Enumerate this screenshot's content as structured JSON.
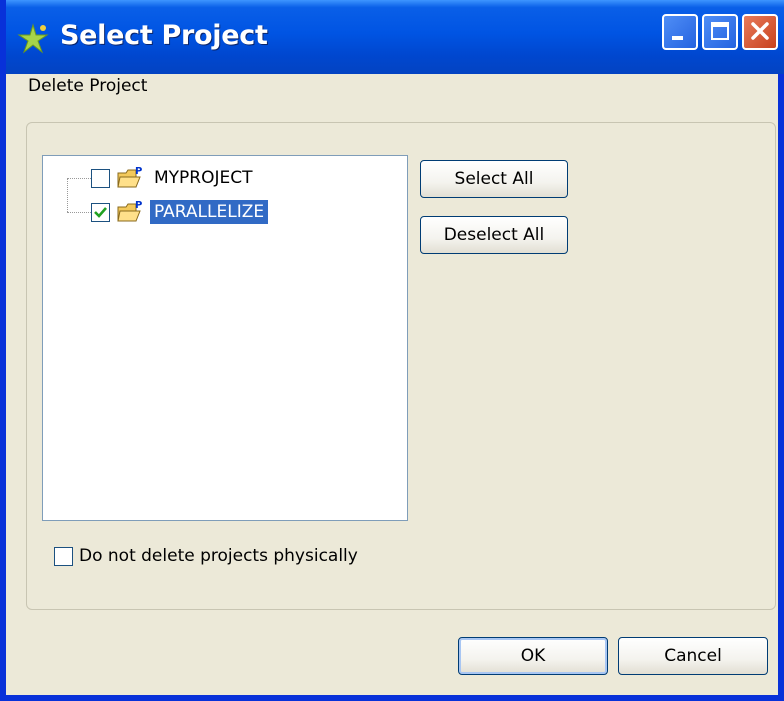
{
  "window": {
    "title": "Select Project",
    "subtitle": "Delete Project"
  },
  "titlebar_buttons": {
    "minimize_icon": "minimize-icon",
    "maximize_icon": "maximize-icon",
    "close_icon": "close-icon"
  },
  "tree": {
    "items": [
      {
        "label": "MYPROJECT",
        "checked": false,
        "selected": false
      },
      {
        "label": "PARALLELIZE",
        "checked": true,
        "selected": true
      }
    ]
  },
  "actions": {
    "select_all_label": "Select All",
    "deselect_all_label": "Deselect All"
  },
  "options": {
    "do_not_delete_label": "Do not delete projects physically",
    "do_not_delete_checked": false
  },
  "footer": {
    "ok_label": "OK",
    "cancel_label": "Cancel"
  },
  "colors": {
    "titlebar": "#0054e3",
    "selection": "#316ac5",
    "dialog_bg": "#ece9d8"
  }
}
